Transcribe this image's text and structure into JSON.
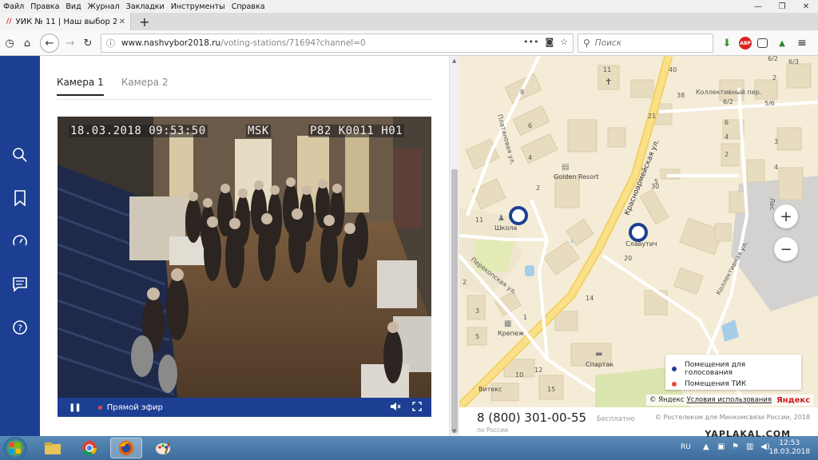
{
  "menu": [
    "Файл",
    "Правка",
    "Вид",
    "Журнал",
    "Закладки",
    "Инструменты",
    "Справка"
  ],
  "window_controls": {
    "minimize": "—",
    "restore": "❐",
    "close": "✕"
  },
  "tab": {
    "title": "УИК № 11 | Наш выбор 2018",
    "favicon": "//",
    "close": "✕"
  },
  "newtab": "+",
  "url": {
    "host": "www.nashvybor2018.ru",
    "path": "/voting-stations/71694?channel=0",
    "info_icon": "ⓘ"
  },
  "search": {
    "placeholder": "Поиск"
  },
  "extensions": {
    "abp": "ABP"
  },
  "camera_tabs": [
    "Камера 1",
    "Камера 2"
  ],
  "osd": {
    "datetime": "18.03.2018 09:53:50",
    "tz": "MSK",
    "code": "P82 K0011 H01"
  },
  "player": {
    "live_label": "Прямой эфир"
  },
  "map": {
    "streets": [
      "Красноармейская ул.",
      "Платановая ул.",
      "Перекопская ул.",
      "Коллективная ул.",
      "Коллективный пер.",
      "Лес"
    ],
    "places": [
      "Golden Resort",
      "Школа",
      "Славутич",
      "Крепеж",
      "Спартак",
      "Витекс"
    ],
    "numbers": [
      "11",
      "40",
      "8",
      "6",
      "4",
      "2",
      "11",
      "21",
      "38",
      "6/2",
      "6/3",
      "6/2",
      "4",
      "5/6",
      "2",
      "3",
      "4",
      "6",
      "2",
      "30",
      "20",
      "14",
      "2",
      "3",
      "5",
      "10",
      "12",
      "15",
      "1",
      "5"
    ],
    "zoom_in": "+",
    "zoom_out": "−",
    "legend": [
      {
        "label": "Помещения для голосования",
        "color": "#1d3f93"
      },
      {
        "label": "Помещения ТИК",
        "color": "#e94a3a"
      }
    ],
    "copyright": {
      "prefix": "© Яндекс",
      "link": "Условия использования",
      "brand": "Яндекс"
    }
  },
  "footer": {
    "phone": "8 (800) 301-00-55",
    "phone_sub": "по России",
    "free": "Бесплатно",
    "legal": "© Ростелеком для Минкомсвязи России, 2018"
  },
  "taskbar": {
    "lang": "RU",
    "time": "12:53",
    "date": "18.03.2018",
    "watermark": "YAPLAKAL.COM"
  }
}
